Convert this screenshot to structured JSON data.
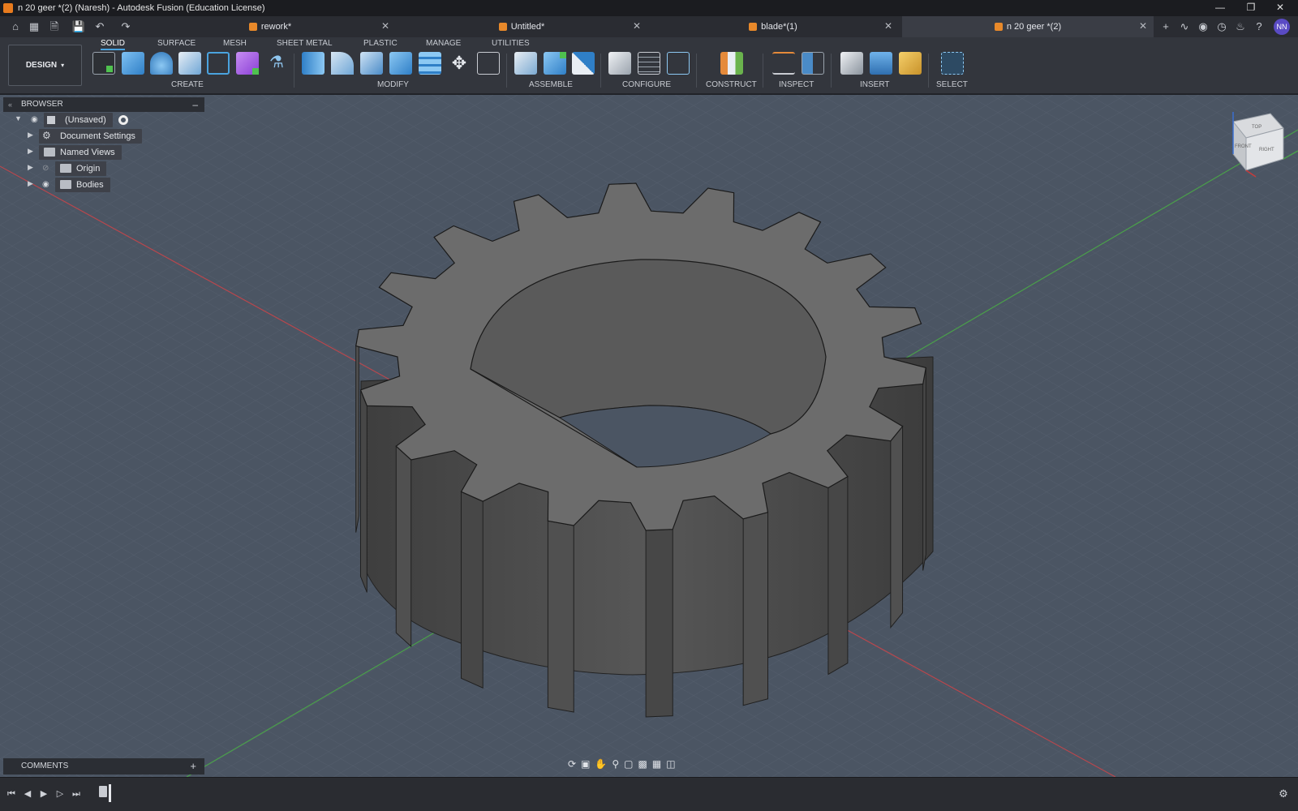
{
  "window": {
    "title": "n 20 geer *(2) (Naresh) - Autodesk Fusion (Education License)"
  },
  "tabs": [
    {
      "label": "rework*",
      "active": false
    },
    {
      "label": "Untitled*",
      "active": false
    },
    {
      "label": "blade*(1)",
      "active": false
    },
    {
      "label": "n 20 geer *(2)",
      "active": true
    }
  ],
  "user": {
    "initials": "NN"
  },
  "workspace": {
    "mode_label": "DESIGN",
    "tabs": [
      "SOLID",
      "SURFACE",
      "MESH",
      "SHEET METAL",
      "PLASTIC",
      "MANAGE",
      "UTILITIES"
    ],
    "active_tab": "SOLID"
  },
  "toolbar_groups": [
    "CREATE",
    "MODIFY",
    "ASSEMBLE",
    "CONFIGURE",
    "CONSTRUCT",
    "INSPECT",
    "INSERT",
    "SELECT"
  ],
  "browser": {
    "title": "BROWSER",
    "items": [
      {
        "label": "(Unsaved)"
      },
      {
        "label": "Document Settings"
      },
      {
        "label": "Named Views"
      },
      {
        "label": "Origin"
      },
      {
        "label": "Bodies"
      }
    ]
  },
  "comments": {
    "title": "COMMENTS"
  },
  "viewcube": {
    "faces": [
      "TOP",
      "FRONT",
      "RIGHT"
    ]
  },
  "colors": {
    "accent": "#4aa3df",
    "tab_icon": "#e8892a",
    "viewport_bg": "#4b5563",
    "gear_top": "#6b6b6b",
    "gear_side": "#4a4a4a"
  }
}
